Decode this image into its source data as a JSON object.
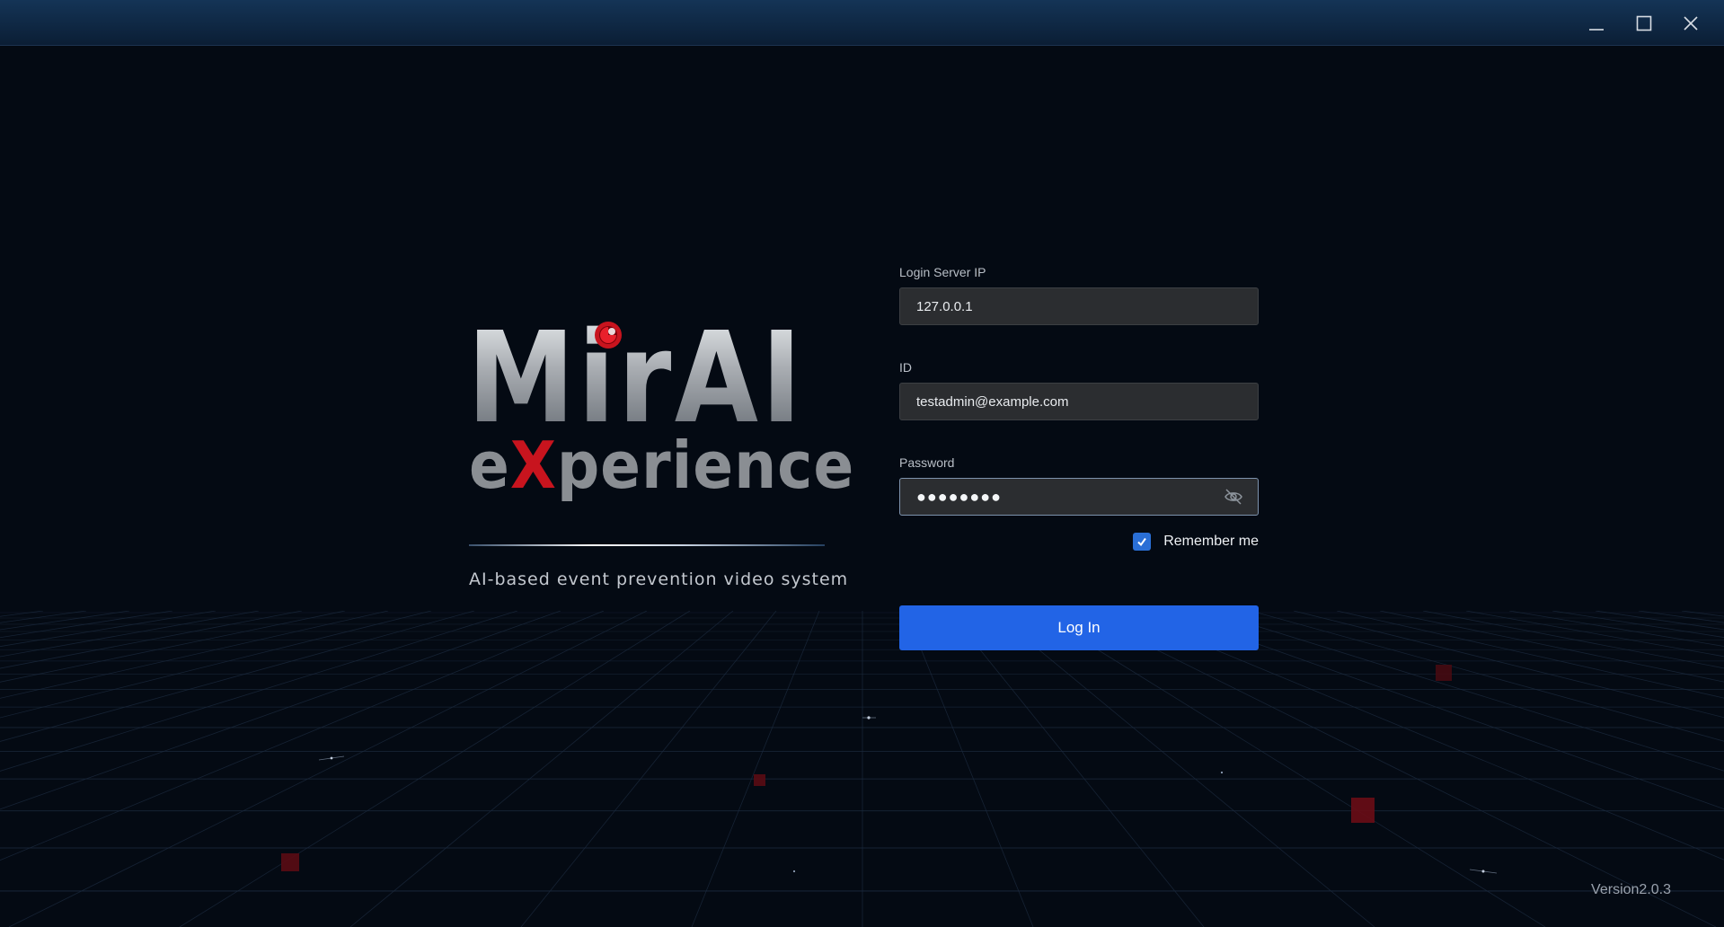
{
  "window": {
    "controls": [
      "minimize-icon",
      "maximize-icon",
      "close-icon"
    ]
  },
  "branding": {
    "logo_main": "MirAI",
    "logo_sub_pre": "e",
    "logo_sub_x": "X",
    "logo_sub_post": "perience",
    "tagline": "AI-based event prevention video system",
    "accent_red": "#c8141e"
  },
  "form": {
    "server_ip": {
      "label": "Login Server IP",
      "value": "127.0.0.1"
    },
    "id": {
      "label": "ID",
      "value": "testadmin@example.com"
    },
    "password": {
      "label": "Password",
      "masked": "●●●●●●●●",
      "icon": "eye-off-icon"
    },
    "remember": {
      "label": "Remember me",
      "checked": true
    },
    "login_label": "Log In"
  },
  "footer": {
    "version": "Version2.0.3"
  },
  "colors": {
    "primary": "#2264e6",
    "background": "#040a13",
    "titlebar": "#143456"
  }
}
